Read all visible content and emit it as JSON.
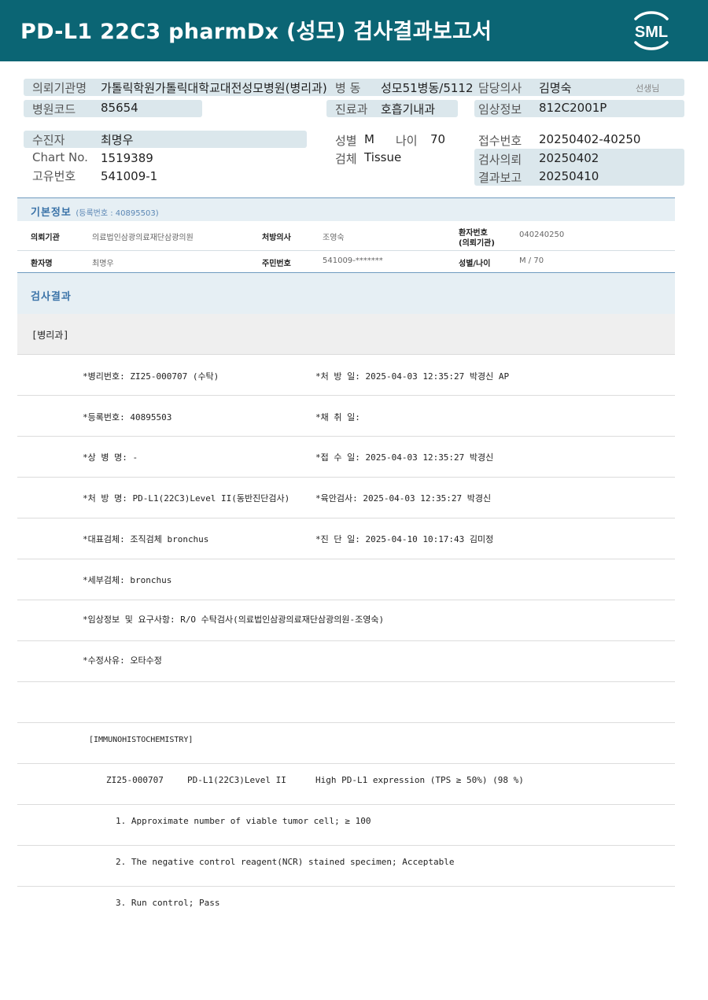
{
  "header": {
    "title": "PD-L1 22C3 pharmDx (성모) 검사결과보고서",
    "logo_text": "SML"
  },
  "top": {
    "institution_label": "의뢰기관명",
    "institution_value": "가톨릭학원가톨릭대학교대전성모병원(병리과)",
    "ward_label": "병 동",
    "ward_value": "성모51병동/5112",
    "doctor_label": "담당의사",
    "doctor_value": "김명숙",
    "doctor_suffix": "선생님",
    "hospital_code_label": "병원코드",
    "hospital_code_value": "85654",
    "dept_label": "진료과",
    "dept_value": "호흡기내과",
    "clinical_label": "임상정보",
    "clinical_value": "812C2001P",
    "patient_label": "수진자",
    "patient_value": "최명우",
    "sex_label": "성별",
    "sex_value": "M",
    "age_label": "나이",
    "age_value": "70",
    "receipt_no_label": "접수번호",
    "receipt_no_value": "20250402-40250",
    "chart_label": "Chart No.",
    "chart_value": "1519389",
    "specimen_label": "검체",
    "specimen_value": "Tissue",
    "request_label": "검사의뢰",
    "request_value": "20250402",
    "unique_label": "고유번호",
    "unique_value": "541009-1",
    "report_label": "결과보고",
    "report_value": "20250410"
  },
  "basic_info": {
    "title": "기본정보",
    "reg_no": "(등록번호 : 40895503)",
    "row1": {
      "inst_label": "의뢰기관",
      "inst_value": "의료법인삼광의료재단삼광의원",
      "doc_label": "처방의사",
      "doc_value": "조영숙",
      "patno_label_1": "환자번호",
      "patno_label_2": "(의뢰기관)",
      "patno_value": "040240250"
    },
    "row2": {
      "name_label": "환자명",
      "name_value": "최명우",
      "rrn_label": "주민번호",
      "rrn_value": "541009-*******",
      "sexage_label": "성별/나이",
      "sexage_value": "M / 70"
    }
  },
  "results": {
    "title": "검사결과",
    "dept": "[병리과]",
    "lines": [
      {
        "left": "*병리번호: ZI25-000707 (수탁)",
        "right": "*처 방 일: 2025-04-03 12:35:27  박경신 AP"
      },
      {
        "left": "*등록번호: 40895503",
        "right": "*채 취 일:"
      },
      {
        "left": "*상 병 명: -",
        "right": "*접 수 일: 2025-04-03 12:35:27  박경신"
      },
      {
        "left": "*처 방 명: PD-L1(22C3)Level II(동반진단검사)",
        "right": "*육안검사: 2025-04-03 12:35:27  박경신"
      },
      {
        "left": "*대표검체: 조직검체 bronchus",
        "right": "*진 단 일: 2025-04-10 10:17:43  김미정"
      },
      {
        "left": "*세부검체: bronchus",
        "right": ""
      },
      {
        "left": "*임상정보 및 요구사항: R/O 수탁검사(의료법인삼광의료재단삼광의원-조영숙)",
        "right": ""
      },
      {
        "left": "*수정사유: 오타수정",
        "right": ""
      }
    ],
    "ihc_header": "[IMMUNOHISTOCHEMISTRY]",
    "ihc_row": {
      "id": "ZI25-000707",
      "test": "PD-L1(22C3)Level II",
      "result": "High PD-L1 expression (TPS ≥ 50%) (98 %)"
    },
    "notes": [
      "1. Approximate number of viable tumor cell; ≥ 100",
      "2. The negative control reagent(NCR) stained specimen; Acceptable",
      "3. Run control; Pass"
    ]
  },
  "colors": {
    "header_bg": "#0b6574",
    "box_bg": "#dbe7ec",
    "section_title": "#3a73a8"
  }
}
